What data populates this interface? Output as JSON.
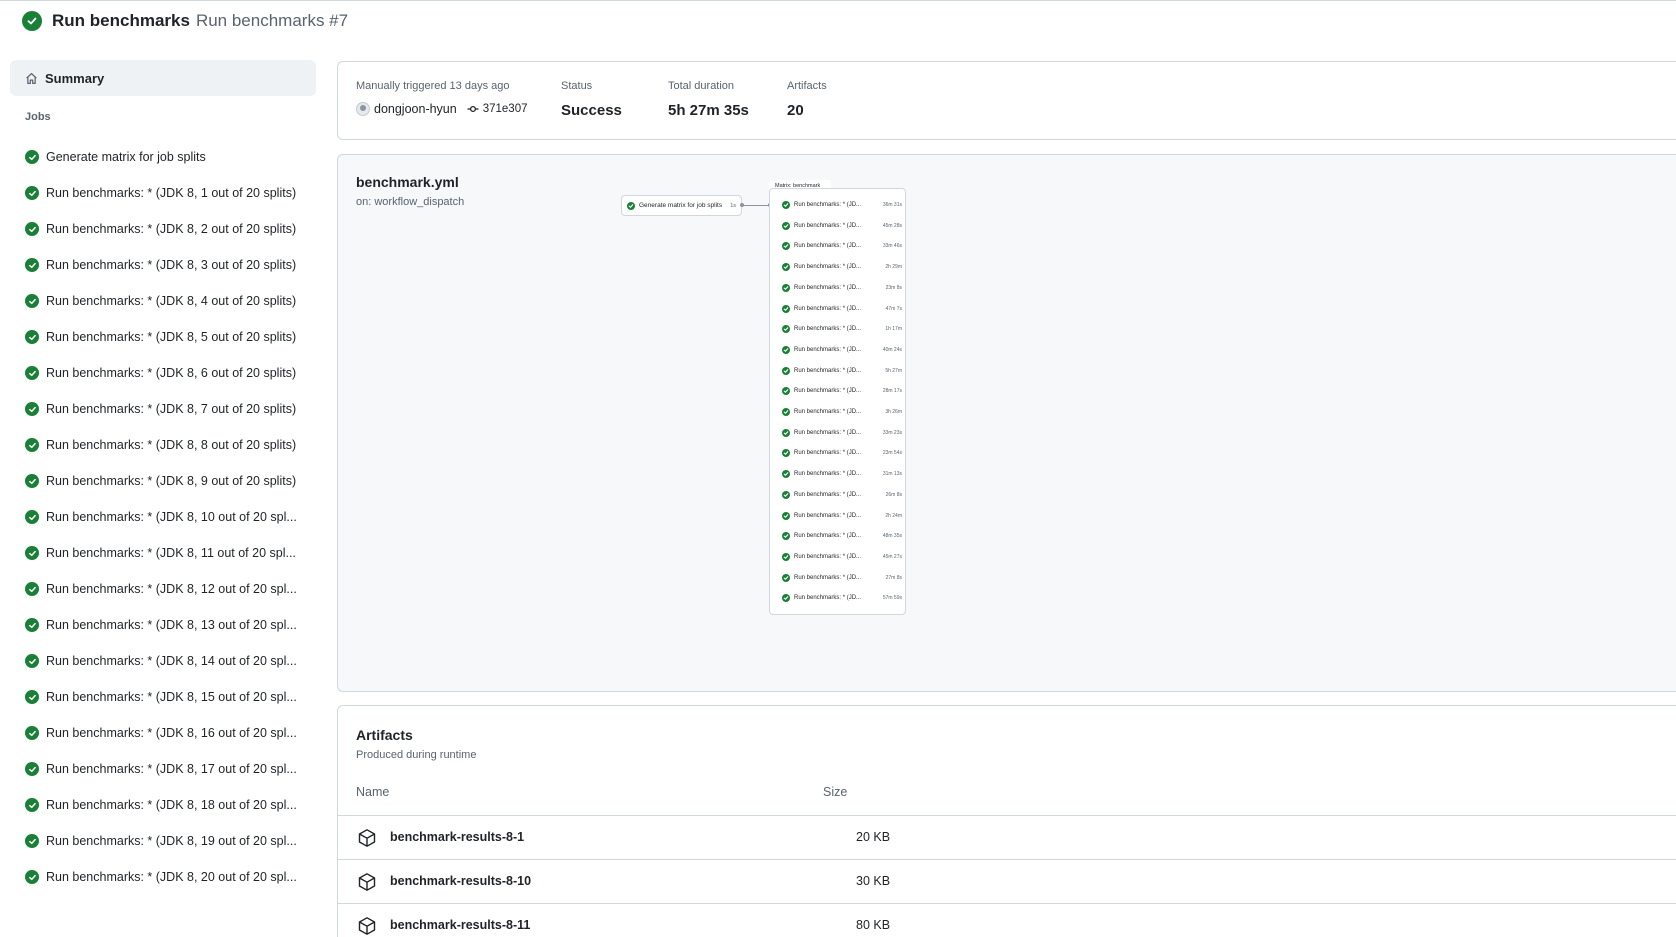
{
  "header": {
    "workflow": "Run benchmarks",
    "run": "Run benchmarks #7"
  },
  "sidebar": {
    "summary_label": "Summary",
    "jobs_heading": "Jobs",
    "jobs": [
      "Generate matrix for job splits",
      "Run benchmarks: * (JDK 8, 1 out of 20 splits)",
      "Run benchmarks: * (JDK 8, 2 out of 20 splits)",
      "Run benchmarks: * (JDK 8, 3 out of 20 splits)",
      "Run benchmarks: * (JDK 8, 4 out of 20 splits)",
      "Run benchmarks: * (JDK 8, 5 out of 20 splits)",
      "Run benchmarks: * (JDK 8, 6 out of 20 splits)",
      "Run benchmarks: * (JDK 8, 7 out of 20 splits)",
      "Run benchmarks: * (JDK 8, 8 out of 20 splits)",
      "Run benchmarks: * (JDK 8, 9 out of 20 splits)",
      "Run benchmarks: * (JDK 8, 10 out of 20 spl...",
      "Run benchmarks: * (JDK 8, 11 out of 20 spl...",
      "Run benchmarks: * (JDK 8, 12 out of 20 spl...",
      "Run benchmarks: * (JDK 8, 13 out of 20 spl...",
      "Run benchmarks: * (JDK 8, 14 out of 20 spl...",
      "Run benchmarks: * (JDK 8, 15 out of 20 spl...",
      "Run benchmarks: * (JDK 8, 16 out of 20 spl...",
      "Run benchmarks: * (JDK 8, 17 out of 20 spl...",
      "Run benchmarks: * (JDK 8, 18 out of 20 spl...",
      "Run benchmarks: * (JDK 8, 19 out of 20 spl...",
      "Run benchmarks: * (JDK 8, 20 out of 20 spl..."
    ]
  },
  "info": {
    "trigger_caption": "Manually triggered 13 days ago",
    "actor": "dongjoon-hyun",
    "commit": "371e307",
    "status_caption": "Status",
    "status_value": "Success",
    "duration_caption": "Total duration",
    "duration_value": "5h 27m 35s",
    "artifacts_caption": "Artifacts",
    "artifacts_value": "20"
  },
  "graph": {
    "file": "benchmark.yml",
    "trigger": "on: workflow_dispatch",
    "generate_node": {
      "label": "Generate matrix for job splits",
      "duration": "1s"
    },
    "matrix_title": "Matrix: benchmark",
    "matrix_label": "Run benchmarks: * (JD...",
    "matrix_durations": [
      "36m 31s",
      "45m 28s",
      "33m 46s",
      "2h 29m",
      "23m 8s",
      "47m 7s",
      "1h 17m",
      "40m 24s",
      "5h 27m",
      "28m 17s",
      "3h 26m",
      "33m 23s",
      "23m 54s",
      "31m 13s",
      "26m 8s",
      "2h 24m",
      "48m 35s",
      "45m 27s",
      "27m 8s",
      "57m 59s"
    ]
  },
  "artifacts": {
    "title": "Artifacts",
    "subtitle": "Produced during runtime",
    "col_name": "Name",
    "col_size": "Size",
    "rows": [
      {
        "name": "benchmark-results-8-1",
        "size": "20 KB"
      },
      {
        "name": "benchmark-results-8-10",
        "size": "30 KB"
      },
      {
        "name": "benchmark-results-8-11",
        "size": "80 KB"
      }
    ]
  },
  "colors": {
    "success": "#1a7f37",
    "border": "#d0d7de",
    "muted": "#59636e"
  },
  "icons": [
    "check-circle-icon",
    "home-icon",
    "commit-icon",
    "package-icon"
  ]
}
